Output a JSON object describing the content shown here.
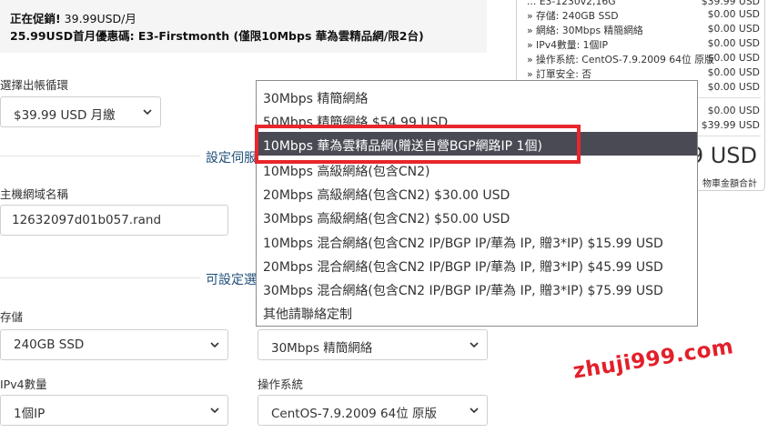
{
  "promo": {
    "line1_label": "正在促銷!",
    "line1_value": " 39.99USD/月",
    "line2_label": "25.99USD首月優惠碼:",
    "line2_value": " E3-Firstmonth (僅限10Mbps 華為雲精品網/限2台)"
  },
  "summary": {
    "top_partial_label": "... E3-1230v2,16G",
    "top_partial_value": "$39.99 USD",
    "items": [
      {
        "label": "» 存儲: 240GB SSD",
        "value": "$0.00 USD"
      },
      {
        "label": "» 網絡: 30Mbps 精簡網絡",
        "value": "$0.00 USD"
      },
      {
        "label": "» IPv4數量: 1個IP",
        "value": "$0.00 USD"
      },
      {
        "label": "» 操作系統: CentOS-7.9.2009 64位 原版",
        "value": "$0.00 USD"
      },
      {
        "label": "» 訂單安全: 否",
        "value": "$0.00 USD"
      },
      {
        "label": "",
        "value": "$0.00 USD"
      }
    ],
    "sub_rows": [
      {
        "label": "",
        "value": "$0.00 USD"
      },
      {
        "label": "",
        "value": "$39.99 USD"
      }
    ],
    "total": "9 USD",
    "total_caption": "物車金額合計"
  },
  "form": {
    "billing_label": "選擇出帳循環",
    "billing_value": "$39.99 USD 月繳",
    "section_config": "設定伺服",
    "hostname_label": "主機網域名稱",
    "hostname_value": "12632097d01b057.rand",
    "section_options": "可設定選",
    "storage_label": "存儲",
    "storage_value": "240GB SSD",
    "network_value": "30Mbps 精簡網絡",
    "ipv4_label": "IPv4數量",
    "ipv4_value": "1個IP",
    "os_label": "操作系統",
    "os_value": "CentOS-7.9.2009 64位 原版"
  },
  "dropdown": {
    "options": [
      "30Mbps 精簡網絡",
      "50Mbps 精簡網絡 $54.99 USD",
      "10Mbps 華為雲精品網(贈送自營BGP網路IP 1個)",
      "10Mbps 高級網絡(包含CN2)",
      "20Mbps 高級網絡(包含CN2) $30.00 USD",
      "30Mbps 高級網絡(包含CN2) $50.00 USD",
      "10Mbps 混合網絡(包含CN2 IP/BGP IP/華為 IP, 贈3*IP) $15.99 USD",
      "20Mbps 混合網絡(包含CN2 IP/BGP IP/華為 IP, 贈3*IP) $45.99 USD",
      "30Mbps 混合網絡(包含CN2 IP/BGP IP/華為 IP, 贈3*IP) $75.99 USD",
      "其他請聯絡定制"
    ],
    "selected_index": 2
  },
  "watermark": "zhuji999.com",
  "colors": {
    "highlight": "#4a4a55",
    "annotation": "#e8262b",
    "section": "#1f4e79"
  }
}
